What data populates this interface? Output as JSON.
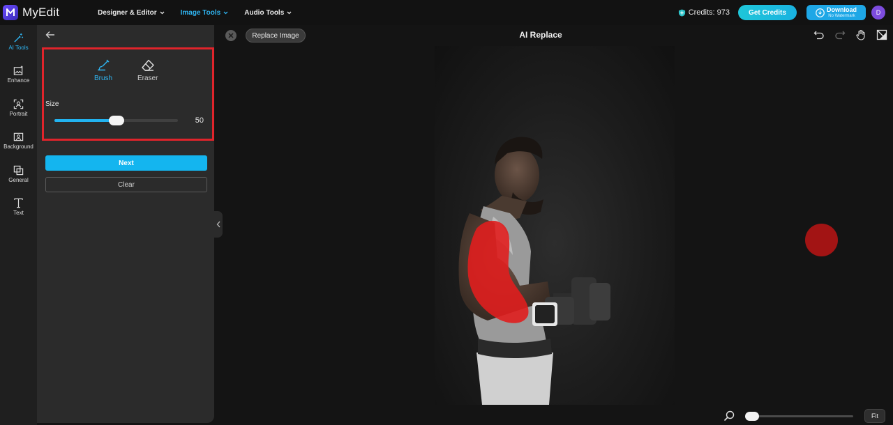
{
  "app": {
    "name": "MyEdit"
  },
  "topnav": {
    "items": [
      {
        "label": "Designer & Editor",
        "active": false
      },
      {
        "label": "Image Tools",
        "active": true
      },
      {
        "label": "Audio Tools",
        "active": false
      }
    ]
  },
  "account": {
    "credits_label": "Credits: 973",
    "get_credits_label": "Get Credits",
    "download_label": "Download",
    "download_sublabel": "No Watermark",
    "avatar_initial": "D"
  },
  "rail": {
    "items": [
      {
        "label": "AI Tools",
        "icon": "magic-wand-icon",
        "active": true
      },
      {
        "label": "Enhance",
        "icon": "image-sparkle-icon",
        "active": false
      },
      {
        "label": "Portrait",
        "icon": "portrait-icon",
        "active": false
      },
      {
        "label": "Background",
        "icon": "background-icon",
        "active": false
      },
      {
        "label": "General",
        "icon": "layers-icon",
        "active": false
      },
      {
        "label": "Text",
        "icon": "text-icon",
        "active": false
      }
    ]
  },
  "panel": {
    "tools": [
      {
        "label": "Brush",
        "icon": "brush-icon",
        "active": true
      },
      {
        "label": "Eraser",
        "icon": "eraser-icon",
        "active": false
      }
    ],
    "size_label": "Size",
    "size_value": "50",
    "size_fraction": 0.5,
    "next_label": "Next",
    "clear_label": "Clear"
  },
  "canvas": {
    "replace_label": "Replace Image",
    "title": "AI Replace",
    "tools": [
      "undo-icon",
      "redo-icon",
      "hand-icon",
      "compare-icon"
    ],
    "zoom_fraction": 0.0,
    "fit_label": "Fit"
  },
  "colors": {
    "accent": "#14b5ef",
    "highlight_box": "#e0242b",
    "mask": "#e01e1e",
    "rail_bg": "#1f1f1f",
    "panel_bg": "#2b2b2b"
  }
}
